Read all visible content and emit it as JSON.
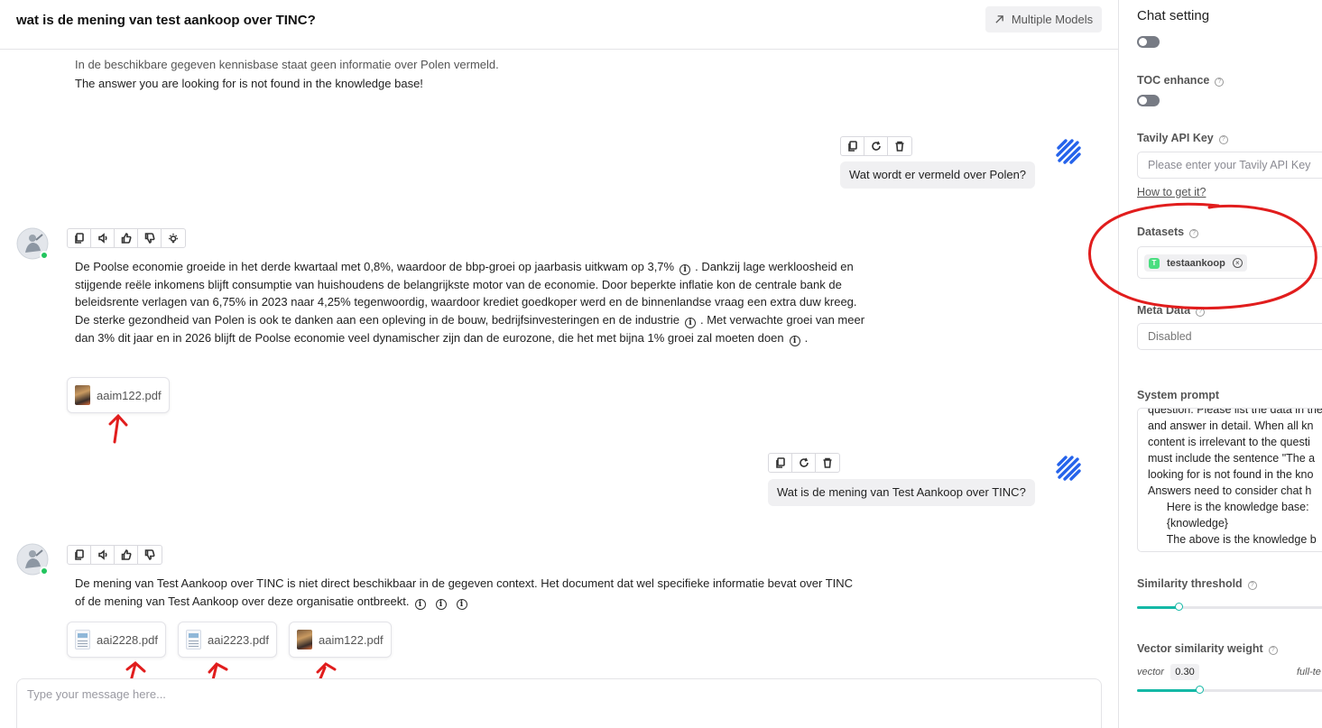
{
  "header": {
    "title": "wat is de mening van test aankoop over TINC?",
    "multiple_models_label": "Multiple Models"
  },
  "conversation": {
    "prev_cut_line": "In de beschikbare gegeven kennisbase staat geen informatie over Polen vermeld.",
    "prev_answer_line": "The answer you are looking for is not found in the knowledge base!",
    "user_message_1": "Wat wordt er vermeld over Polen?",
    "answer_1": {
      "seg1": "De Poolse economie groeide in het derde kwartaal met 0,8%, waardoor de bbp-groei op jaarbasis uitkwam op 3,7%",
      "seg2": ". Dankzij lage werkloosheid en stijgende reële inkomens blijft consumptie van huishoudens de belangrijkste motor van de economie. Door beperkte inflatie kon de centrale bank de beleidsrente verlagen van 6,75% in 2023 naar 4,25% tegenwoordig, waardoor krediet goedkoper werd en de binnenlandse vraag een extra duw kreeg. De sterke gezondheid van Polen is ook te danken aan een opleving in de bouw, bedrijfsinvesteringen en de industrie",
      "seg3": ". Met verwachte groei van meer dan 3% dit jaar en in 2026 blijft de Poolse economie veel dynamischer zijn dan de eurozone, die het met bijna 1% groei zal moeten doen",
      "seg4": "."
    },
    "answer_1_docs": [
      "aaim122.pdf"
    ],
    "user_message_2": "Wat is de mening van Test Aankoop over TINC?",
    "answer_2": {
      "text": "De mening van Test Aankoop over TINC is niet direct beschikbaar in de gegeven context. Het document dat wel specifieke informatie bevat over TINC of de mening van Test Aankoop over deze organisatie ontbreekt."
    },
    "answer_2_docs": [
      "aai2228.pdf",
      "aai2223.pdf",
      "aaim122.pdf"
    ]
  },
  "composer": {
    "placeholder": "Type your message here..."
  },
  "settings": {
    "title": "Chat setting",
    "toc_label": "TOC enhance",
    "tavily_label": "Tavily API Key",
    "tavily_placeholder": "Please enter your Tavily API Key",
    "how_link": "How to get it?",
    "datasets_label": "Datasets",
    "dataset_chip": "testaankoop",
    "dataset_chip_letter": "T",
    "metadata_label": "Meta Data",
    "metadata_value": "Disabled",
    "system_prompt_label": "System prompt",
    "system_prompt_text": "question. Please list the data in the\nand answer in detail. When all kn\ncontent is irrelevant to the questi\nmust include the sentence \"The a\nlooking for is not found in the kno\nAnswers need to consider chat h\n      Here is the knowledge base:\n      {knowledge}\n      The above is the knowledge b",
    "similarity_label": "Similarity threshold",
    "similarity_value": 0.2,
    "vector_weight_label": "Vector similarity weight",
    "vector_sub": "vector",
    "vector_value": "0.30",
    "fulltext_sub": "full-te",
    "vector_slider_value": 0.3
  },
  "colors": {
    "accent": "#14b8a6",
    "online": "#22c55e",
    "annotation": "#e11d1d"
  }
}
